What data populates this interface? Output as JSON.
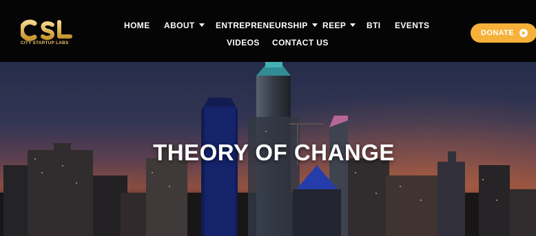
{
  "brand": {
    "logo_text": "CITY STARTUP LABS",
    "logo_mark": "CSL",
    "accent": "#e8c06a"
  },
  "nav": {
    "items": [
      {
        "label": "HOME",
        "dropdown": false
      },
      {
        "label": "ABOUT",
        "dropdown": true
      },
      {
        "label": "ENTREPRENEURSHIP",
        "dropdown": true
      },
      {
        "label": "REEP",
        "dropdown": true
      },
      {
        "label": "BTI",
        "dropdown": false
      },
      {
        "label": "EVENTS",
        "dropdown": false
      },
      {
        "label": "VIDEOS",
        "dropdown": false
      },
      {
        "label": "CONTACT US",
        "dropdown": false
      }
    ]
  },
  "donate": {
    "label": "DONATE",
    "color": "#f6b13a",
    "icon": "arrow-circle-right-icon"
  },
  "hero": {
    "title": "THEORY OF CHANGE",
    "background": "city-skyline-dusk"
  }
}
